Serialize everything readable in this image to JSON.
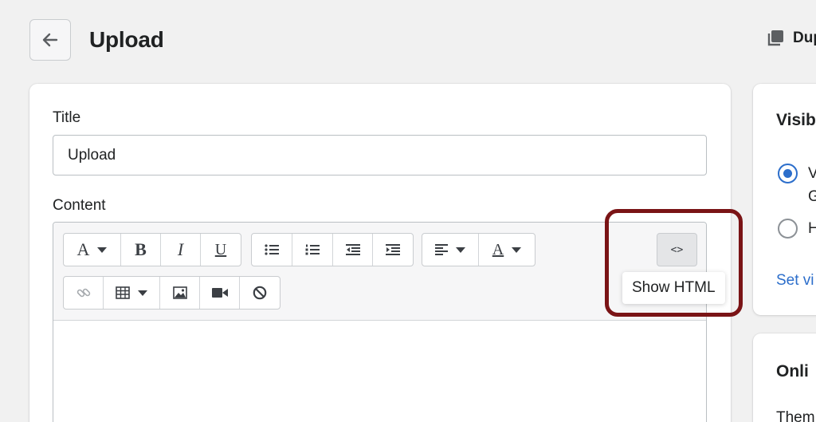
{
  "header": {
    "title": "Upload",
    "duplicate_label": "Dup"
  },
  "form": {
    "title_label": "Title",
    "title_value": "Upload",
    "content_label": "Content"
  },
  "toolbar": {
    "font_glyph": "A",
    "bold_glyph": "B",
    "italic_glyph": "I",
    "underline_glyph": "U",
    "color_glyph": "A",
    "html_glyph": "<>",
    "tooltip": "Show HTML"
  },
  "sidebar": {
    "visibility_heading": "Visib",
    "option1_line1": "V",
    "option1_line2": "G",
    "option2": "H",
    "set_link": "Set vi",
    "online_heading": "Onli",
    "online_text": "Them"
  },
  "colors": {
    "accent": "#2c6ecb",
    "highlight": "#7a1416",
    "background": "#f1f1f1"
  }
}
